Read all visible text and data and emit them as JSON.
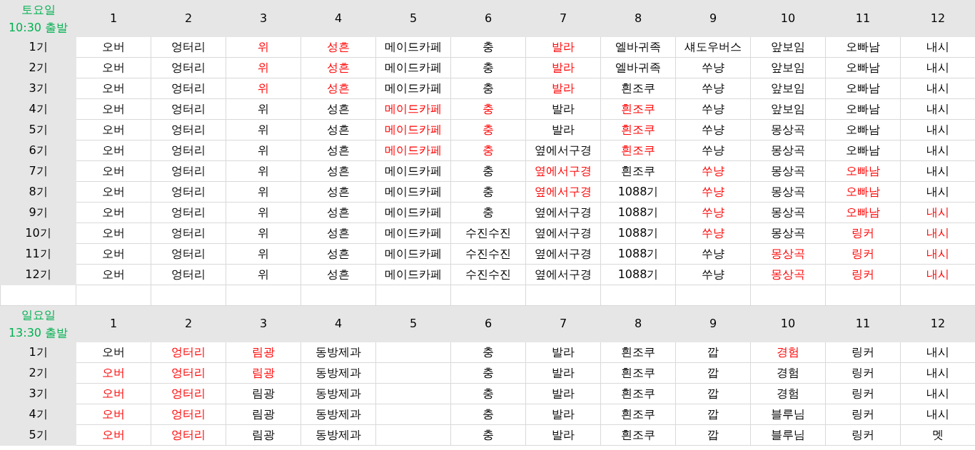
{
  "sections": [
    {
      "day": "토요일",
      "time": "10:30 출발",
      "columns": [
        "1",
        "2",
        "3",
        "4",
        "5",
        "6",
        "7",
        "8",
        "9",
        "10",
        "11",
        "12"
      ],
      "rows": [
        {
          "label": "1기",
          "cells": [
            {
              "text": "오버",
              "highlighted": false
            },
            {
              "text": "엉터리",
              "highlighted": false
            },
            {
              "text": "위",
              "highlighted": true
            },
            {
              "text": "성흔",
              "highlighted": true
            },
            {
              "text": "메이드카페",
              "highlighted": false
            },
            {
              "text": "충",
              "highlighted": false
            },
            {
              "text": "발라",
              "highlighted": true
            },
            {
              "text": "엘바귀족",
              "highlighted": false
            },
            {
              "text": "섀도우버스",
              "highlighted": false
            },
            {
              "text": "앞보임",
              "highlighted": false
            },
            {
              "text": "오빠남",
              "highlighted": false
            },
            {
              "text": "내시",
              "highlighted": false
            }
          ]
        },
        {
          "label": "2기",
          "cells": [
            {
              "text": "오버",
              "highlighted": false
            },
            {
              "text": "엉터리",
              "highlighted": false
            },
            {
              "text": "위",
              "highlighted": true
            },
            {
              "text": "성흔",
              "highlighted": true
            },
            {
              "text": "메이드카페",
              "highlighted": false
            },
            {
              "text": "충",
              "highlighted": false
            },
            {
              "text": "발라",
              "highlighted": true
            },
            {
              "text": "엘바귀족",
              "highlighted": false
            },
            {
              "text": "쑤냥",
              "highlighted": false
            },
            {
              "text": "앞보임",
              "highlighted": false
            },
            {
              "text": "오빠남",
              "highlighted": false
            },
            {
              "text": "내시",
              "highlighted": false
            }
          ]
        },
        {
          "label": "3기",
          "cells": [
            {
              "text": "오버",
              "highlighted": false
            },
            {
              "text": "엉터리",
              "highlighted": false
            },
            {
              "text": "위",
              "highlighted": true
            },
            {
              "text": "성흔",
              "highlighted": true
            },
            {
              "text": "메이드카페",
              "highlighted": false
            },
            {
              "text": "충",
              "highlighted": false
            },
            {
              "text": "발라",
              "highlighted": true
            },
            {
              "text": "흰조쿠",
              "highlighted": false
            },
            {
              "text": "쑤냥",
              "highlighted": false
            },
            {
              "text": "앞보임",
              "highlighted": false
            },
            {
              "text": "오빠남",
              "highlighted": false
            },
            {
              "text": "내시",
              "highlighted": false
            }
          ]
        },
        {
          "label": "4기",
          "cells": [
            {
              "text": "오버",
              "highlighted": false
            },
            {
              "text": "엉터리",
              "highlighted": false
            },
            {
              "text": "위",
              "highlighted": false
            },
            {
              "text": "성흔",
              "highlighted": false
            },
            {
              "text": "메이드카페",
              "highlighted": true
            },
            {
              "text": "충",
              "highlighted": true
            },
            {
              "text": "발라",
              "highlighted": false
            },
            {
              "text": "흰조쿠",
              "highlighted": true
            },
            {
              "text": "쑤냥",
              "highlighted": false
            },
            {
              "text": "앞보임",
              "highlighted": false
            },
            {
              "text": "오빠남",
              "highlighted": false
            },
            {
              "text": "내시",
              "highlighted": false
            }
          ]
        },
        {
          "label": "5기",
          "cells": [
            {
              "text": "오버",
              "highlighted": false
            },
            {
              "text": "엉터리",
              "highlighted": false
            },
            {
              "text": "위",
              "highlighted": false
            },
            {
              "text": "성흔",
              "highlighted": false
            },
            {
              "text": "메이드카페",
              "highlighted": true
            },
            {
              "text": "충",
              "highlighted": true
            },
            {
              "text": "발라",
              "highlighted": false
            },
            {
              "text": "흰조쿠",
              "highlighted": true
            },
            {
              "text": "쑤냥",
              "highlighted": false
            },
            {
              "text": "몽상곡",
              "highlighted": false
            },
            {
              "text": "오빠남",
              "highlighted": false
            },
            {
              "text": "내시",
              "highlighted": false
            }
          ]
        },
        {
          "label": "6기",
          "cells": [
            {
              "text": "오버",
              "highlighted": false
            },
            {
              "text": "엉터리",
              "highlighted": false
            },
            {
              "text": "위",
              "highlighted": false
            },
            {
              "text": "성흔",
              "highlighted": false
            },
            {
              "text": "메이드카페",
              "highlighted": true
            },
            {
              "text": "충",
              "highlighted": true
            },
            {
              "text": "옆에서구경",
              "highlighted": false
            },
            {
              "text": "흰조쿠",
              "highlighted": true
            },
            {
              "text": "쑤냥",
              "highlighted": false
            },
            {
              "text": "몽상곡",
              "highlighted": false
            },
            {
              "text": "오빠남",
              "highlighted": false
            },
            {
              "text": "내시",
              "highlighted": false
            }
          ]
        },
        {
          "label": "7기",
          "cells": [
            {
              "text": "오버",
              "highlighted": false
            },
            {
              "text": "엉터리",
              "highlighted": false
            },
            {
              "text": "위",
              "highlighted": false
            },
            {
              "text": "성흔",
              "highlighted": false
            },
            {
              "text": "메이드카페",
              "highlighted": false
            },
            {
              "text": "충",
              "highlighted": false
            },
            {
              "text": "옆에서구경",
              "highlighted": true
            },
            {
              "text": "흰조쿠",
              "highlighted": false
            },
            {
              "text": "쑤냥",
              "highlighted": true
            },
            {
              "text": "몽상곡",
              "highlighted": false
            },
            {
              "text": "오빠남",
              "highlighted": true
            },
            {
              "text": "내시",
              "highlighted": false
            }
          ]
        },
        {
          "label": "8기",
          "cells": [
            {
              "text": "오버",
              "highlighted": false
            },
            {
              "text": "엉터리",
              "highlighted": false
            },
            {
              "text": "위",
              "highlighted": false
            },
            {
              "text": "성흔",
              "highlighted": false
            },
            {
              "text": "메이드카페",
              "highlighted": false
            },
            {
              "text": "충",
              "highlighted": false
            },
            {
              "text": "옆에서구경",
              "highlighted": true
            },
            {
              "text": "1088기",
              "highlighted": false
            },
            {
              "text": "쑤냥",
              "highlighted": true
            },
            {
              "text": "몽상곡",
              "highlighted": false
            },
            {
              "text": "오빠남",
              "highlighted": true
            },
            {
              "text": "내시",
              "highlighted": false
            }
          ]
        },
        {
          "label": "9기",
          "cells": [
            {
              "text": "오버",
              "highlighted": false
            },
            {
              "text": "엉터리",
              "highlighted": false
            },
            {
              "text": "위",
              "highlighted": false
            },
            {
              "text": "성흔",
              "highlighted": false
            },
            {
              "text": "메이드카페",
              "highlighted": false
            },
            {
              "text": "충",
              "highlighted": false
            },
            {
              "text": "옆에서구경",
              "highlighted": false
            },
            {
              "text": "1088기",
              "highlighted": false
            },
            {
              "text": "쑤냥",
              "highlighted": true
            },
            {
              "text": "몽상곡",
              "highlighted": false
            },
            {
              "text": "오빠남",
              "highlighted": true
            },
            {
              "text": "내시",
              "highlighted": true
            }
          ]
        },
        {
          "label": "10기",
          "cells": [
            {
              "text": "오버",
              "highlighted": false
            },
            {
              "text": "엉터리",
              "highlighted": false
            },
            {
              "text": "위",
              "highlighted": false
            },
            {
              "text": "성흔",
              "highlighted": false
            },
            {
              "text": "메이드카페",
              "highlighted": false
            },
            {
              "text": "수진수진",
              "highlighted": false
            },
            {
              "text": "옆에서구경",
              "highlighted": false
            },
            {
              "text": "1088기",
              "highlighted": false
            },
            {
              "text": "쑤냥",
              "highlighted": true
            },
            {
              "text": "몽상곡",
              "highlighted": false
            },
            {
              "text": "링커",
              "highlighted": true
            },
            {
              "text": "내시",
              "highlighted": true
            }
          ]
        },
        {
          "label": "11기",
          "cells": [
            {
              "text": "오버",
              "highlighted": false
            },
            {
              "text": "엉터리",
              "highlighted": false
            },
            {
              "text": "위",
              "highlighted": false
            },
            {
              "text": "성흔",
              "highlighted": false
            },
            {
              "text": "메이드카페",
              "highlighted": false
            },
            {
              "text": "수진수진",
              "highlighted": false
            },
            {
              "text": "옆에서구경",
              "highlighted": false
            },
            {
              "text": "1088기",
              "highlighted": false
            },
            {
              "text": "쑤냥",
              "highlighted": false
            },
            {
              "text": "몽상곡",
              "highlighted": true
            },
            {
              "text": "링커",
              "highlighted": true
            },
            {
              "text": "내시",
              "highlighted": true
            }
          ]
        },
        {
          "label": "12기",
          "cells": [
            {
              "text": "오버",
              "highlighted": false
            },
            {
              "text": "엉터리",
              "highlighted": false
            },
            {
              "text": "위",
              "highlighted": false
            },
            {
              "text": "성흔",
              "highlighted": false
            },
            {
              "text": "메이드카페",
              "highlighted": false
            },
            {
              "text": "수진수진",
              "highlighted": false
            },
            {
              "text": "옆에서구경",
              "highlighted": false
            },
            {
              "text": "1088기",
              "highlighted": false
            },
            {
              "text": "쑤냥",
              "highlighted": false
            },
            {
              "text": "몽상곡",
              "highlighted": true
            },
            {
              "text": "링커",
              "highlighted": true
            },
            {
              "text": "내시",
              "highlighted": true
            }
          ]
        }
      ]
    },
    {
      "day": "일요일",
      "time": "13:30 출발",
      "columns": [
        "1",
        "2",
        "3",
        "4",
        "5",
        "6",
        "7",
        "8",
        "9",
        "10",
        "11",
        "12"
      ],
      "rows": [
        {
          "label": "1기",
          "cells": [
            {
              "text": "오버",
              "highlighted": false
            },
            {
              "text": "엉터리",
              "highlighted": true
            },
            {
              "text": "림광",
              "highlighted": true
            },
            {
              "text": "동방제과",
              "highlighted": false
            },
            null,
            {
              "text": "충",
              "highlighted": false
            },
            {
              "text": "발라",
              "highlighted": false
            },
            {
              "text": "흰조쿠",
              "highlighted": false
            },
            {
              "text": "깝",
              "highlighted": false
            },
            {
              "text": "경험",
              "highlighted": true
            },
            {
              "text": "링커",
              "highlighted": false
            },
            {
              "text": "내시",
              "highlighted": false
            }
          ]
        },
        {
          "label": "2기",
          "cells": [
            {
              "text": "오버",
              "highlighted": true
            },
            {
              "text": "엉터리",
              "highlighted": true
            },
            {
              "text": "림광",
              "highlighted": true
            },
            {
              "text": "동방제과",
              "highlighted": false
            },
            null,
            {
              "text": "충",
              "highlighted": false
            },
            {
              "text": "발라",
              "highlighted": false
            },
            {
              "text": "흰조쿠",
              "highlighted": false
            },
            {
              "text": "깝",
              "highlighted": false
            },
            {
              "text": "경험",
              "highlighted": false
            },
            {
              "text": "링커",
              "highlighted": false
            },
            {
              "text": "내시",
              "highlighted": false
            }
          ]
        },
        {
          "label": "3기",
          "cells": [
            {
              "text": "오버",
              "highlighted": true
            },
            {
              "text": "엉터리",
              "highlighted": true
            },
            {
              "text": "림광",
              "highlighted": false
            },
            {
              "text": "동방제과",
              "highlighted": false
            },
            null,
            {
              "text": "충",
              "highlighted": false
            },
            {
              "text": "발라",
              "highlighted": false
            },
            {
              "text": "흰조쿠",
              "highlighted": false
            },
            {
              "text": "깝",
              "highlighted": false
            },
            {
              "text": "경험",
              "highlighted": false
            },
            {
              "text": "링커",
              "highlighted": false
            },
            {
              "text": "내시",
              "highlighted": false
            }
          ]
        },
        {
          "label": "4기",
          "cells": [
            {
              "text": "오버",
              "highlighted": true
            },
            {
              "text": "엉터리",
              "highlighted": true
            },
            {
              "text": "림광",
              "highlighted": false
            },
            {
              "text": "동방제과",
              "highlighted": false
            },
            null,
            {
              "text": "충",
              "highlighted": false
            },
            {
              "text": "발라",
              "highlighted": false
            },
            {
              "text": "흰조쿠",
              "highlighted": false
            },
            {
              "text": "깝",
              "highlighted": false
            },
            {
              "text": "블루님",
              "highlighted": false
            },
            {
              "text": "링커",
              "highlighted": false
            },
            {
              "text": "내시",
              "highlighted": false
            }
          ]
        },
        {
          "label": "5기",
          "cells": [
            {
              "text": "오버",
              "highlighted": true
            },
            {
              "text": "엉터리",
              "highlighted": true
            },
            {
              "text": "림광",
              "highlighted": false
            },
            {
              "text": "동방제과",
              "highlighted": false
            },
            null,
            {
              "text": "충",
              "highlighted": false
            },
            {
              "text": "발라",
              "highlighted": false
            },
            {
              "text": "흰조쿠",
              "highlighted": false
            },
            {
              "text": "깝",
              "highlighted": false
            },
            {
              "text": "블루님",
              "highlighted": false
            },
            {
              "text": "링커",
              "highlighted": false
            },
            {
              "text": "멧",
              "highlighted": false
            }
          ]
        }
      ]
    }
  ]
}
